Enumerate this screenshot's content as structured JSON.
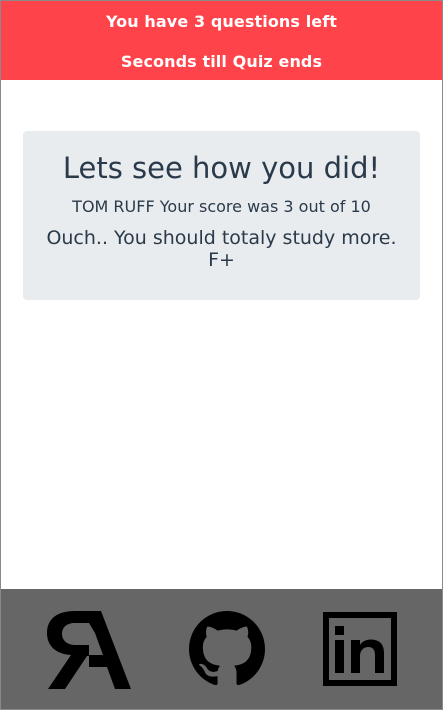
{
  "header": {
    "questions_left": "You have 3 questions left",
    "timer_text": "Seconds till Quiz ends"
  },
  "result": {
    "title": "Lets see how you did!",
    "score_text": "TOM RUFF Your score was 3 out of 10",
    "feedback_message": "Ouch.. You should totaly study more.",
    "grade": "F+"
  },
  "footer": {
    "links": [
      {
        "icon": "portfolio-r-logo-icon"
      },
      {
        "icon": "github-icon"
      },
      {
        "icon": "linkedin-icon"
      }
    ]
  },
  "colors": {
    "header_bg": "#ff434a",
    "card_bg": "#e9ecef",
    "footer_bg": "#666666",
    "text": "#2a3a4a"
  }
}
